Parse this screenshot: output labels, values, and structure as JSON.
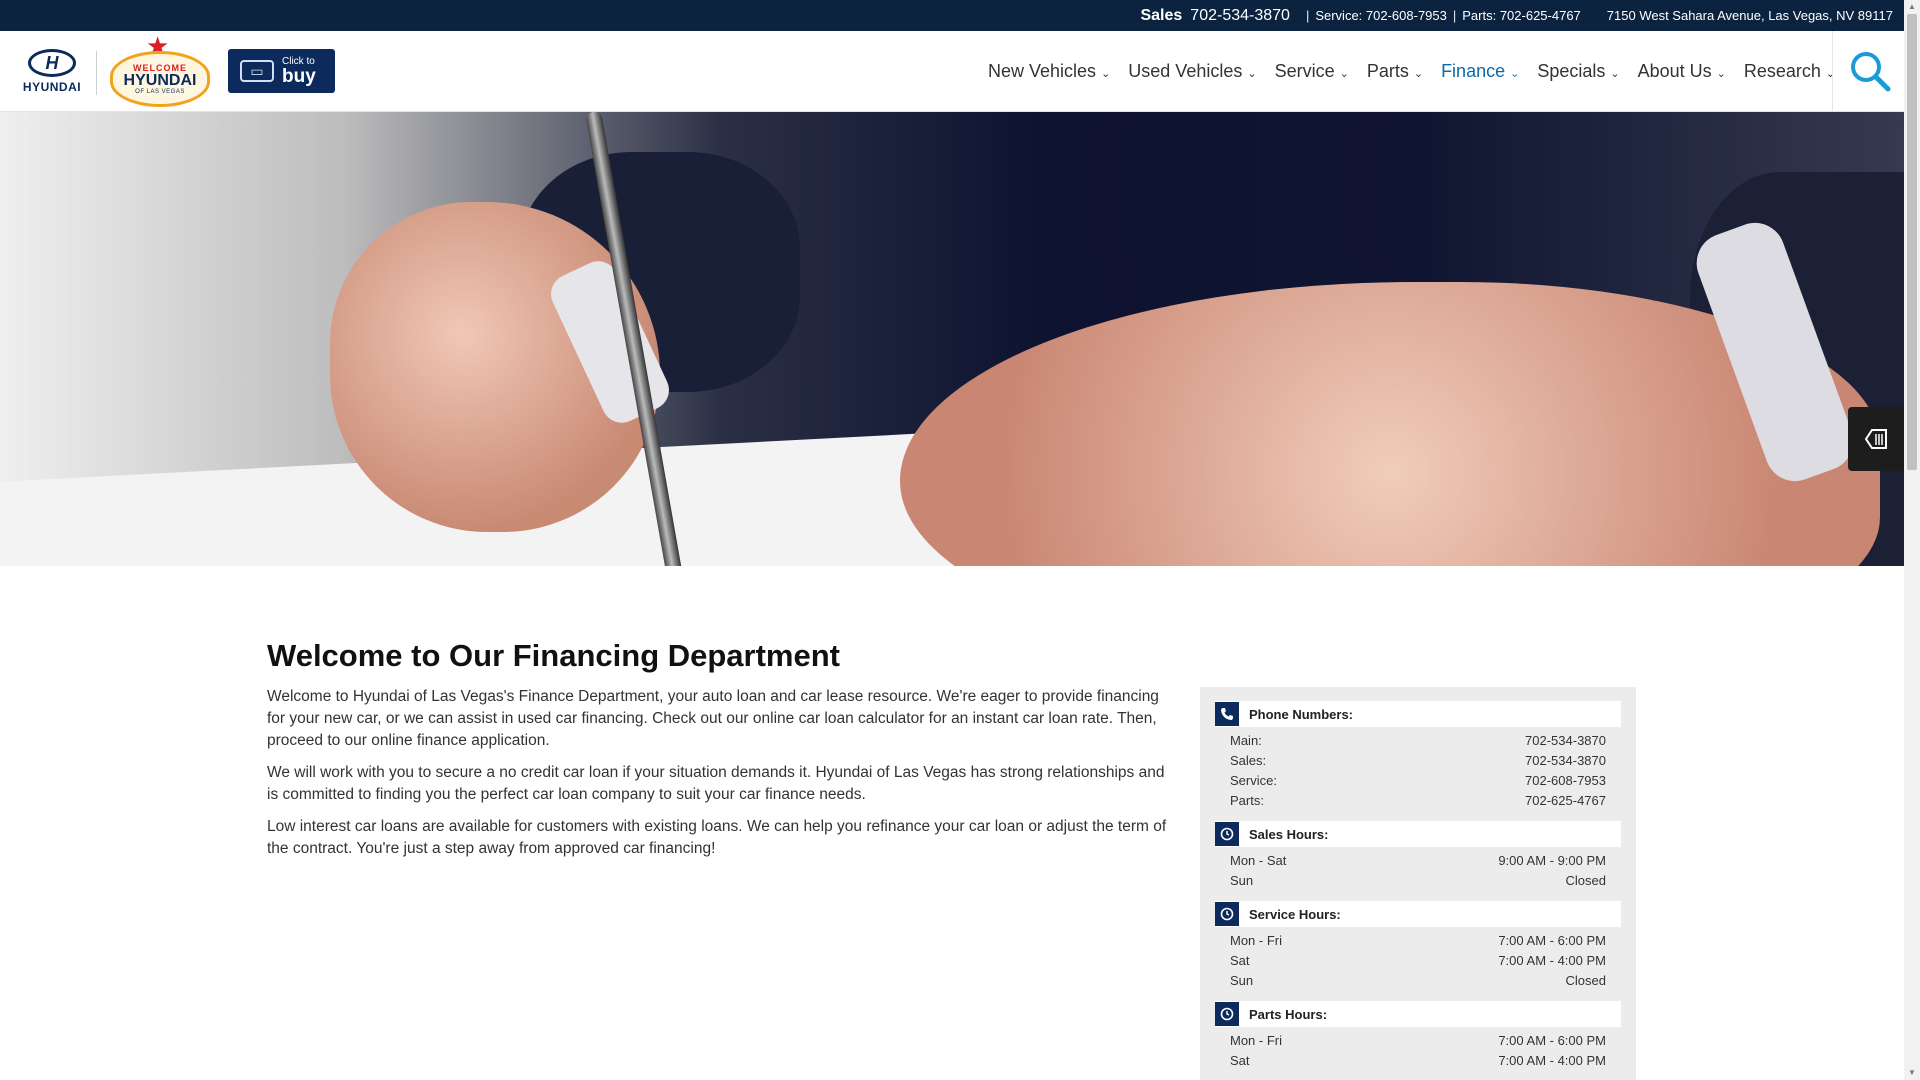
{
  "topbar": {
    "sales_label": "Sales",
    "sales_phone": "702-534-3870",
    "service_text": "Service: 702-608-7953",
    "parts_text": "Parts: 702-625-4767",
    "address": "7150 West Sahara Avenue, Las Vegas, NV 89117"
  },
  "header": {
    "brand_word": "HYUNDAI",
    "brand_mark": "H",
    "dealer_logo": {
      "welcome": "WELCOME",
      "name": "HYUNDAI",
      "city": "OF LAS VEGAS"
    },
    "click_buy": {
      "small": "Click to",
      "big": "buy"
    }
  },
  "nav": {
    "items": [
      {
        "label": "New Vehicles"
      },
      {
        "label": "Used Vehicles"
      },
      {
        "label": "Service"
      },
      {
        "label": "Parts"
      },
      {
        "label": "Finance"
      },
      {
        "label": "Specials"
      },
      {
        "label": "About Us"
      },
      {
        "label": "Research"
      }
    ],
    "active": "Finance",
    "chevron": "⌄"
  },
  "main": {
    "title": "Welcome to Our Financing Department",
    "paragraphs": [
      "Welcome to Hyundai of Las Vegas's Finance Department, your auto loan and car lease resource. We're eager to provide financing for your new car, or we can assist in used car financing. Check out our online car loan calculator for an instant car loan rate. Then, proceed to our online finance application.",
      "We will work with you to secure a no credit car loan if your situation demands it. Hyundai of Las Vegas has strong relationships and is committed to finding you the perfect car loan company to suit your car finance needs.",
      "Low interest car loans are available for customers with existing loans. We can help you refinance your car loan or adjust the term of the contract. You're just a step away from approved car financing!"
    ]
  },
  "panel": {
    "phone": {
      "title": "Phone Numbers:",
      "rows": [
        {
          "k": "Main:",
          "v": "702-534-3870"
        },
        {
          "k": "Sales:",
          "v": "702-534-3870"
        },
        {
          "k": "Service:",
          "v": "702-608-7953"
        },
        {
          "k": "Parts:",
          "v": "702-625-4767"
        }
      ]
    },
    "sales_hours": {
      "title": "Sales Hours:",
      "rows": [
        {
          "k": "Mon - Sat",
          "v": "9:00 AM - 9:00 PM"
        },
        {
          "k": "Sun",
          "v": "Closed"
        }
      ]
    },
    "service_hours": {
      "title": "Service Hours:",
      "rows": [
        {
          "k": "Mon - Fri",
          "v": "7:00 AM - 6:00 PM"
        },
        {
          "k": "Sat",
          "v": "7:00 AM - 4:00 PM"
        },
        {
          "k": "Sun",
          "v": "Closed"
        }
      ]
    },
    "parts_hours": {
      "title": "Parts Hours:",
      "rows": [
        {
          "k": "Mon - Fri",
          "v": "7:00 AM - 6:00 PM"
        },
        {
          "k": "Sat",
          "v": "7:00 AM - 4:00 PM"
        }
      ]
    }
  },
  "colors": {
    "brand_navy": "#0c2340",
    "accent_blue": "#0c6aa8",
    "panel_bg": "#ececec"
  },
  "icons": {
    "search": "search-icon",
    "phone": "phone-icon",
    "clock": "clock-icon",
    "side": "window-sticker-icon"
  }
}
